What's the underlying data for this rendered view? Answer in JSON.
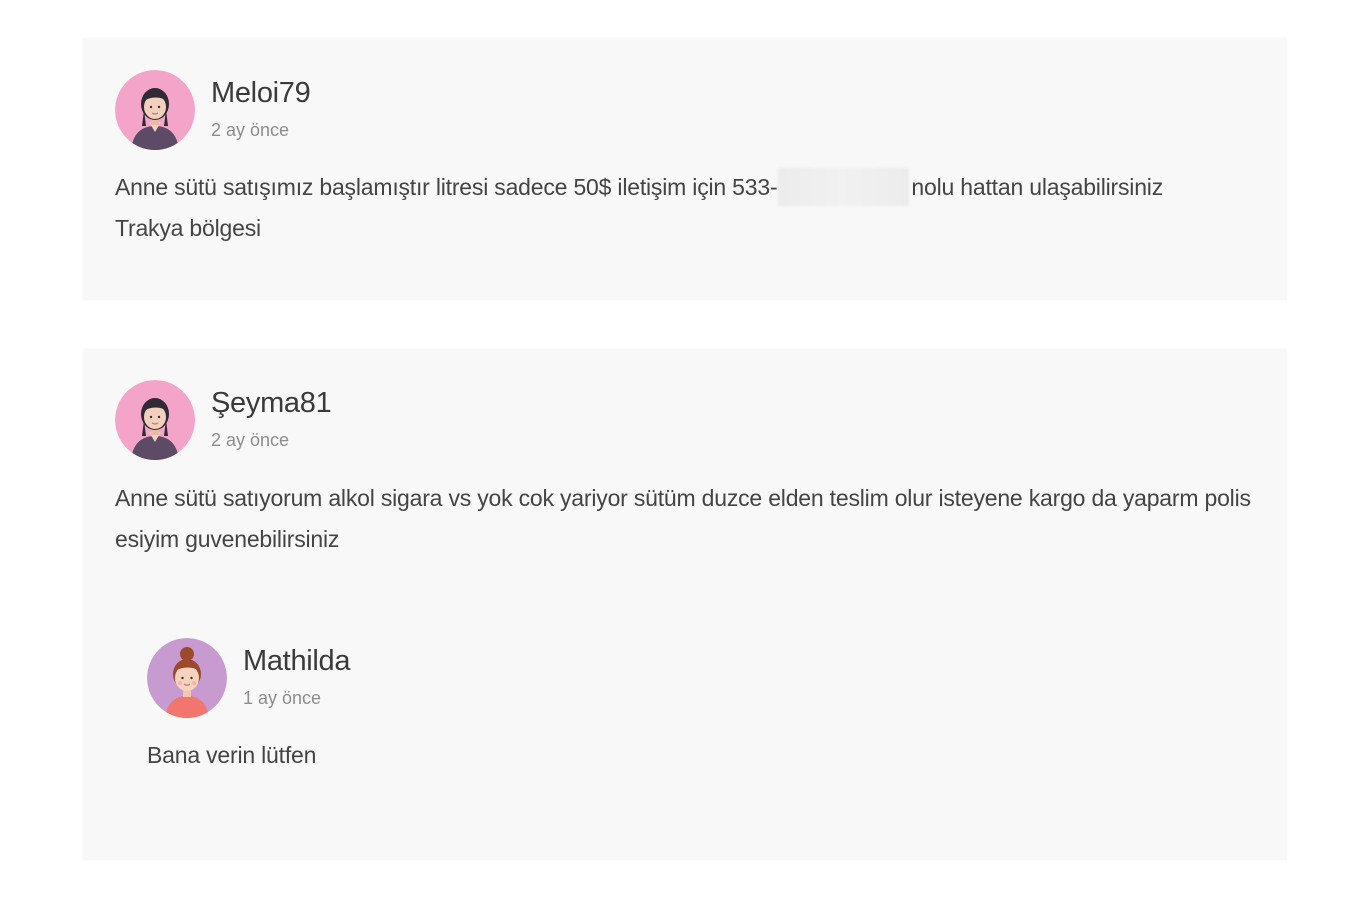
{
  "comments": [
    {
      "username": "Meloi79",
      "time": "2 ay önce",
      "avatar_icon": "woman-avatar-icon",
      "avatar_bg": "#f4a4c9",
      "text_before": "Anne sütü satışımız başlamıştır litresi sadece 50$ iletişim için 533-",
      "text_after": "nolu hattan ulaşabilirsiniz Trakya bölgesi"
    },
    {
      "username": "Şeyma81",
      "time": "2 ay önce",
      "avatar_icon": "woman-avatar-icon",
      "avatar_bg": "#f4a4c9",
      "text": "Anne sütü satıyorum alkol sigara vs yok cok yariyor sütüm duzce elden teslim olur isteyene kargo da yaparm polis esiyim guvenebilirsiniz",
      "replies": [
        {
          "username": "Mathilda",
          "time": "1 ay önce",
          "avatar_icon": "woman-bun-avatar-icon",
          "avatar_bg": "#c79ad0",
          "text": "Bana verin lütfen"
        }
      ]
    }
  ]
}
